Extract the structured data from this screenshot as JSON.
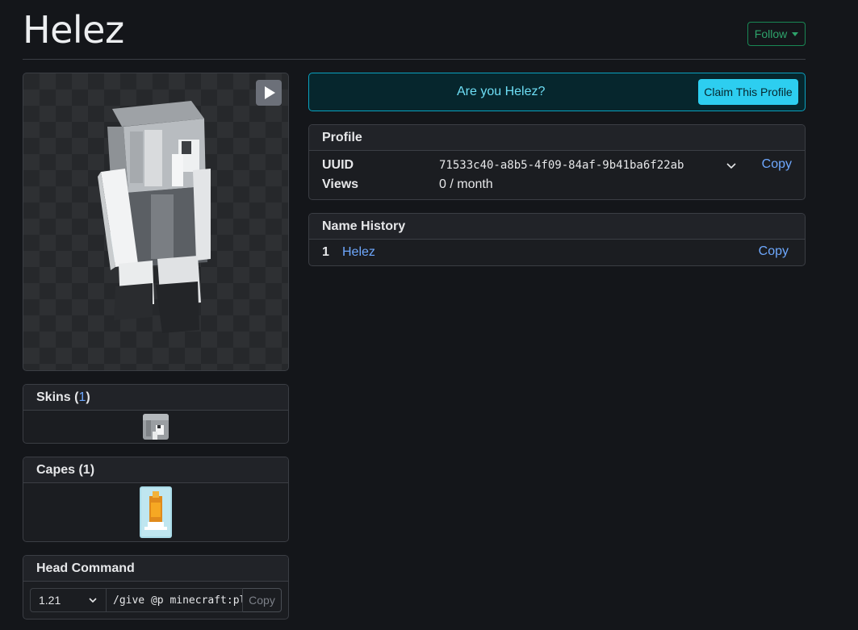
{
  "header": {
    "title": "Helez",
    "follow_label": "Follow"
  },
  "viewer": {
    "play_icon": "play-icon"
  },
  "skins": {
    "title": "Skins",
    "count": "1"
  },
  "capes": {
    "title": "Capes (1)"
  },
  "head_command": {
    "title": "Head Command",
    "version": "1.21",
    "command": "/give @p minecraft:player_head",
    "copy_label": "Copy"
  },
  "claim": {
    "text": "Are you Helez?",
    "button_label": "Claim This Profile"
  },
  "profile": {
    "title": "Profile",
    "uuid_label": "UUID",
    "uuid_value": "71533c40-a8b5-4f09-84af-9b41ba6f22ab",
    "copy_label": "Copy",
    "views_label": "Views",
    "views_value": "0 / month"
  },
  "name_history": {
    "title": "Name History",
    "items": [
      {
        "index": "1",
        "name": "Helez",
        "copy_label": "Copy"
      }
    ]
  },
  "colors": {
    "background": "#14161a",
    "accent_link": "#6ea8fe",
    "follow_green": "#198754",
    "claim_cyan": "#2dcef0"
  }
}
